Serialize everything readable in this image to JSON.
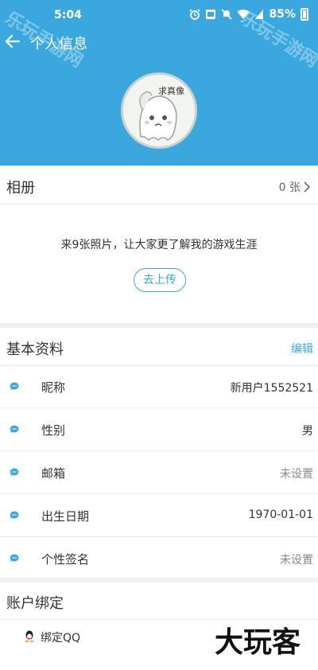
{
  "status_bar": {
    "time": "5:04",
    "icons": [
      "alarm-icon",
      "volte-icon",
      "mute-icon",
      "wifi-icon",
      "signal-icon"
    ],
    "battery": "85%"
  },
  "header": {
    "title": "个人信息",
    "avatar_caption": "求真像"
  },
  "album": {
    "title": "相册",
    "count": "0 张",
    "tip": "来9张照片，让大家更了解我的游戏生涯",
    "upload_label": "去上传"
  },
  "basic_info": {
    "title": "基本资料",
    "edit_label": "编辑",
    "rows": [
      {
        "label": "昵称",
        "value": "新用户1552521"
      },
      {
        "label": "性别",
        "value": "男"
      },
      {
        "label": "邮箱",
        "value": "未设置"
      },
      {
        "label": "出生日期",
        "value": "1970-01-01"
      },
      {
        "label": "个性签名",
        "value": "未设置"
      }
    ]
  },
  "account_binding": {
    "title": "账户绑定",
    "qq_label": "绑定QQ"
  },
  "watermarks": {
    "top_left": "乐玩手游网",
    "top_right": "乐玩手游网",
    "bottom_right": "大玩客"
  },
  "colors": {
    "accent": "#3aa8df",
    "background": "#f0f0f0",
    "text": "#333333",
    "muted": "#888888"
  }
}
